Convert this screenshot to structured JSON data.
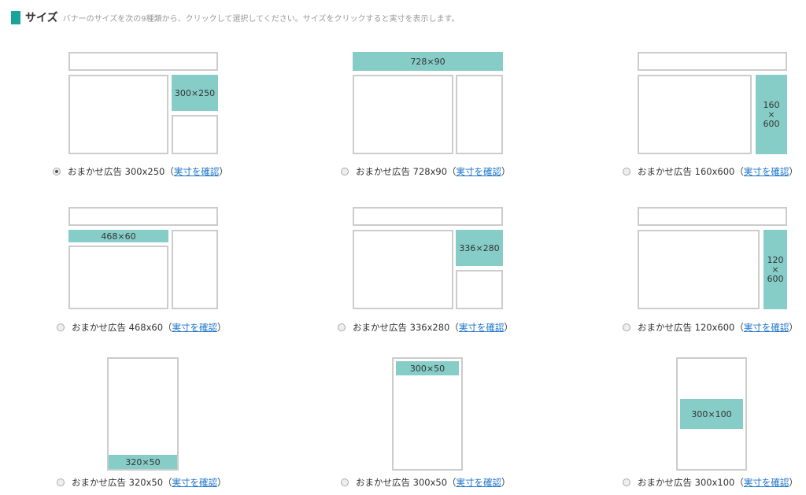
{
  "header": {
    "title": "サイズ",
    "description": "バナーのサイズを次の9種類から、クリックして選択してください。サイズをクリックすると実寸を表示します。",
    "accent_color": "#1aa39a"
  },
  "link_label": "実寸を確認",
  "paren_open": "（",
  "paren_close": "）",
  "options": [
    {
      "label": "おまかせ広告 300x250",
      "preview": "300×250",
      "selected": true
    },
    {
      "label": "おまかせ広告 728x90",
      "preview": "728×90",
      "selected": false
    },
    {
      "label": "おまかせ広告 160x600",
      "preview": [
        "160",
        "×",
        "600"
      ],
      "selected": false
    },
    {
      "label": "おまかせ広告 468x60",
      "preview": "468×60",
      "selected": false
    },
    {
      "label": "おまかせ広告 336x280",
      "preview": "336×280",
      "selected": false
    },
    {
      "label": "おまかせ広告 120x600",
      "preview": [
        "120",
        "×",
        "600"
      ],
      "selected": false
    },
    {
      "label": "おまかせ広告 320x50",
      "preview": "320×50",
      "selected": false
    },
    {
      "label": "おまかせ広告 300x50",
      "preview": "300×50",
      "selected": false
    },
    {
      "label": "おまかせ広告 300x100",
      "preview": "300×100",
      "selected": false
    }
  ],
  "colors": {
    "ad_fill": "#86cdc8",
    "frame_border": "#cccccc",
    "link": "#1a73c9"
  }
}
